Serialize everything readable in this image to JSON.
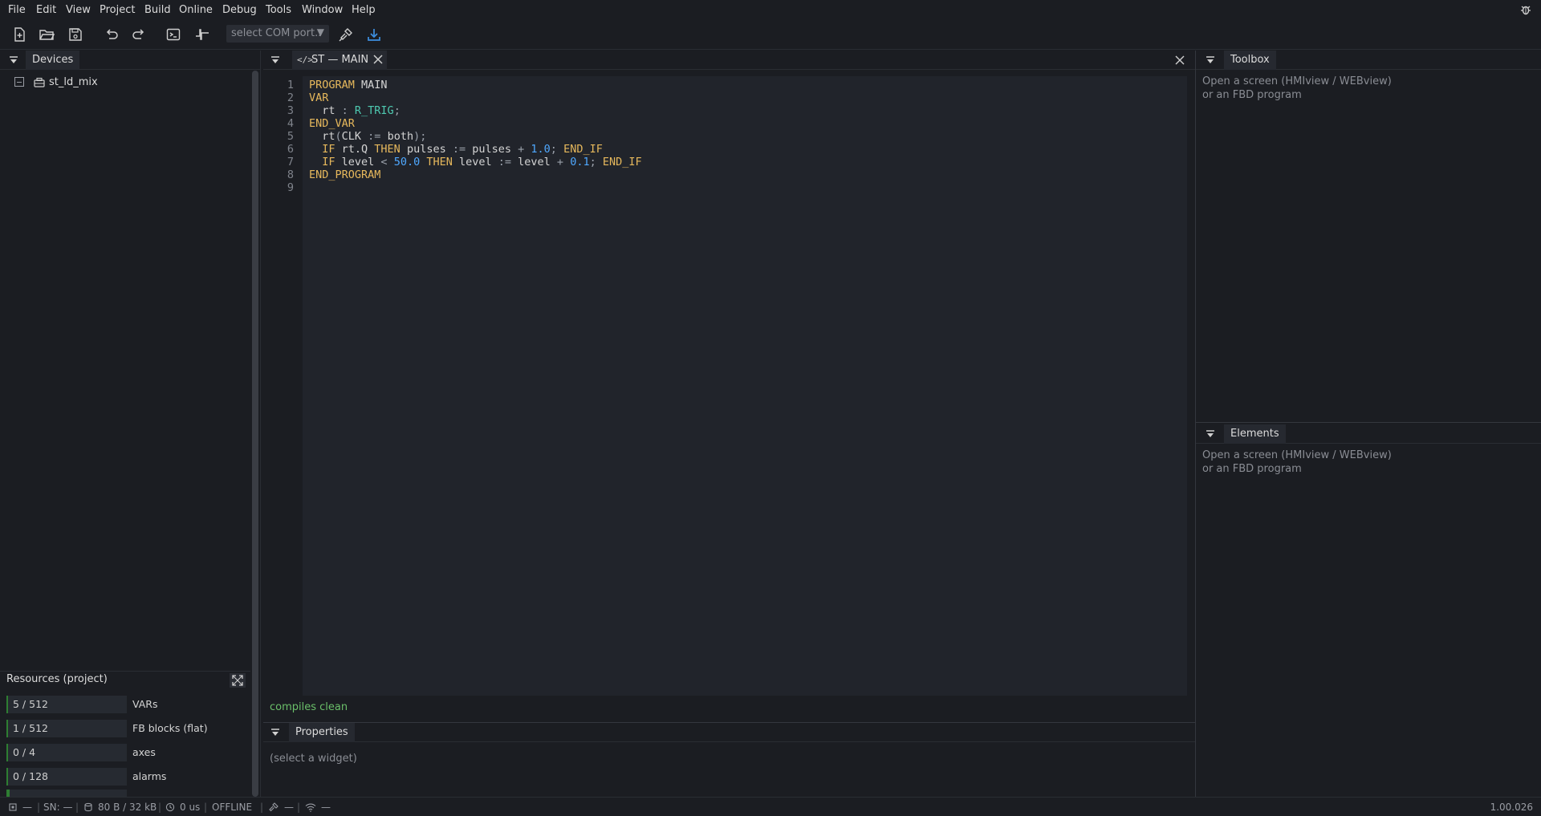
{
  "menu": [
    "File",
    "Edit",
    "View",
    "Project",
    "Build",
    "Online",
    "Debug",
    "Tools",
    "Window",
    "Help"
  ],
  "toolbar": {
    "com_port_placeholder": "select COM port.."
  },
  "devices_panel": {
    "title": "Devices",
    "tree": [
      {
        "label": "st_ld_mix",
        "expander": "−"
      }
    ]
  },
  "resources": {
    "title": "Resources (project)",
    "rows": [
      {
        "value": "5 / 512",
        "label": "VARs"
      },
      {
        "value": "1 / 512",
        "label": "FB blocks (flat)"
      },
      {
        "value": "0 / 4",
        "label": "axes"
      },
      {
        "value": "0 / 128",
        "label": "alarms"
      }
    ]
  },
  "editor": {
    "tab_label": "ST — MAIN",
    "line_numbers": [
      "1",
      "2",
      "3",
      "4",
      "5",
      "6",
      "7",
      "8",
      "9"
    ],
    "status": "compiles clean",
    "lines": [
      [
        {
          "t": "PROGRAM",
          "c": "kw"
        },
        {
          "t": " MAIN",
          "c": "id"
        }
      ],
      [
        {
          "t": "VAR",
          "c": "kw"
        }
      ],
      [
        {
          "t": "  rt ",
          "c": "id"
        },
        {
          "t": ":",
          "c": "op"
        },
        {
          "t": " R_TRIG",
          "c": "ty"
        },
        {
          "t": ";",
          "c": "op"
        }
      ],
      [
        {
          "t": "END_VAR",
          "c": "kw"
        }
      ],
      [
        {
          "t": "  rt",
          "c": "id"
        },
        {
          "t": "(",
          "c": "op"
        },
        {
          "t": "CLK ",
          "c": "id"
        },
        {
          "t": ":=",
          "c": "op"
        },
        {
          "t": " both",
          "c": "id"
        },
        {
          "t": ");",
          "c": "op"
        }
      ],
      [
        {
          "t": "  IF",
          "c": "kw"
        },
        {
          "t": " rt.Q ",
          "c": "id"
        },
        {
          "t": "THEN",
          "c": "kw"
        },
        {
          "t": " pulses ",
          "c": "id"
        },
        {
          "t": ":=",
          "c": "op"
        },
        {
          "t": " pulses ",
          "c": "id"
        },
        {
          "t": "+",
          "c": "op"
        },
        {
          "t": " 1.0",
          "c": "num"
        },
        {
          "t": ";",
          "c": "op"
        },
        {
          "t": " END_IF",
          "c": "kw"
        }
      ],
      [
        {
          "t": "  IF",
          "c": "kw"
        },
        {
          "t": " level ",
          "c": "id"
        },
        {
          "t": "<",
          "c": "op"
        },
        {
          "t": " 50.0",
          "c": "num"
        },
        {
          "t": " THEN",
          "c": "kw"
        },
        {
          "t": " level ",
          "c": "id"
        },
        {
          "t": ":=",
          "c": "op"
        },
        {
          "t": " level ",
          "c": "id"
        },
        {
          "t": "+",
          "c": "op"
        },
        {
          "t": " 0.1",
          "c": "num"
        },
        {
          "t": ";",
          "c": "op"
        },
        {
          "t": " END_IF",
          "c": "kw"
        }
      ],
      [
        {
          "t": "END_PROGRAM",
          "c": "kw"
        }
      ],
      []
    ]
  },
  "properties": {
    "title": "Properties",
    "placeholder": "(select a widget)"
  },
  "toolbox": {
    "title": "Toolbox",
    "line1": "Open a screen (HMIview / WEBview)",
    "line2": "or an FBD program"
  },
  "elements": {
    "title": "Elements",
    "line1": "Open a screen (HMIview / WEBview)",
    "line2": "or an FBD program"
  },
  "statusbar": {
    "conn": "—",
    "sn": "SN: —",
    "memory": "80 B / 32 kB",
    "cycle": "0 us",
    "mode": "OFFLINE",
    "link": "—",
    "wifi": "—",
    "version": "1.00.026"
  },
  "colors": {
    "background": "#1b1d22",
    "editor_bg": "#21242b",
    "keyword": "#e6b85c",
    "type": "#4ec9b0",
    "number": "#4fa8ff",
    "ok_green": "#6abf69",
    "accent_blue": "#3d8fe0"
  }
}
